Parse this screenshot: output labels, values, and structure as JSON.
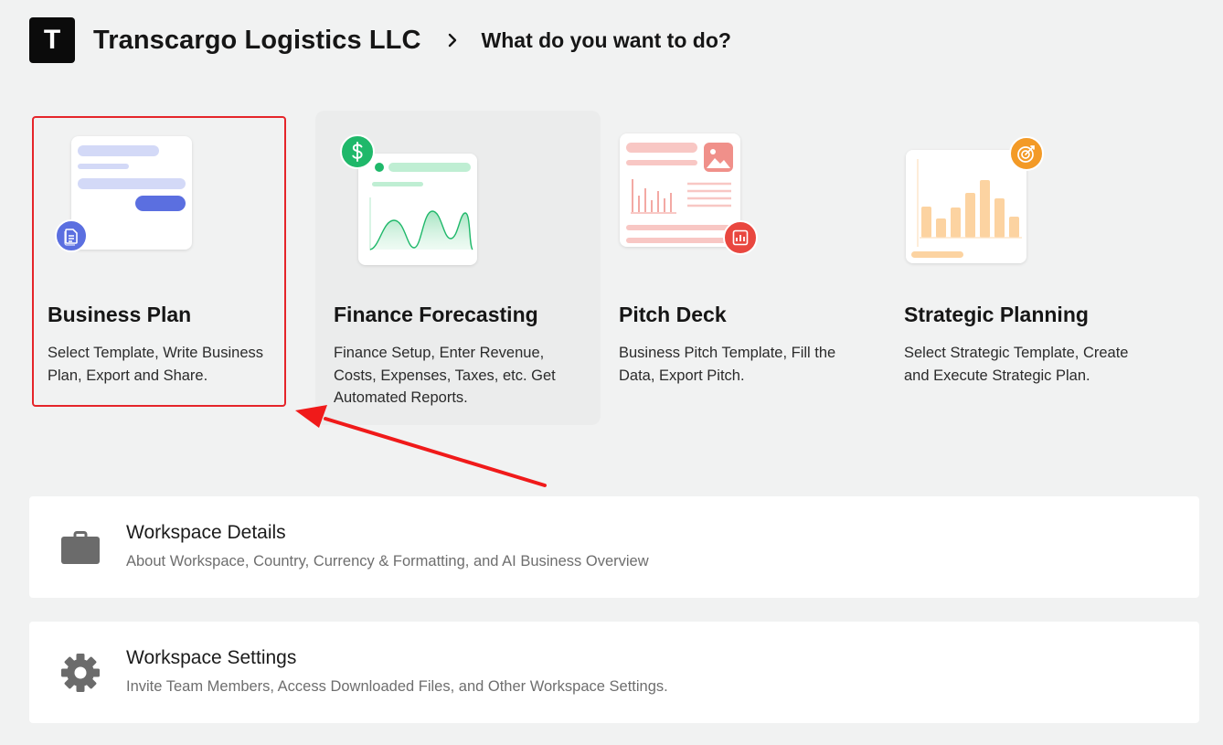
{
  "header": {
    "avatar_letter": "T",
    "company": "Transcargo Logistics LLC",
    "prompt": "What do you want to do?"
  },
  "cards": [
    {
      "title": "Business Plan",
      "description": "Select Template, Write Business Plan, Export and Share.",
      "badge_icon": "document-icon",
      "accent": "#5b6fe0"
    },
    {
      "title": "Finance Forecasting",
      "description": "Finance Setup, Enter Revenue, Costs, Expenses, Taxes, etc. Get Automated Reports.",
      "badge_icon": "dollar-icon",
      "accent": "#1fb86a"
    },
    {
      "title": "Pitch Deck",
      "description": "Business Pitch Template, Fill the Data, Export Pitch.",
      "badge_icon": "chart-icon",
      "accent": "#e9473f"
    },
    {
      "title": "Strategic Planning",
      "description": "Select Strategic Template, Create and Execute Strategic Plan.",
      "badge_icon": "target-icon",
      "accent": "#f39a26"
    }
  ],
  "rows": [
    {
      "title": "Workspace Details",
      "description": "About Workspace, Country, Currency & Formatting, and AI Business Overview",
      "icon": "briefcase-icon"
    },
    {
      "title": "Workspace Settings",
      "description": "Invite Team Members, Access Downloaded Files, and Other Workspace Settings.",
      "icon": "gear-icon"
    }
  ],
  "colors": {
    "background": "#f1f2f2",
    "highlight": "#e5252a",
    "icon_gray": "#6b6b6b"
  }
}
